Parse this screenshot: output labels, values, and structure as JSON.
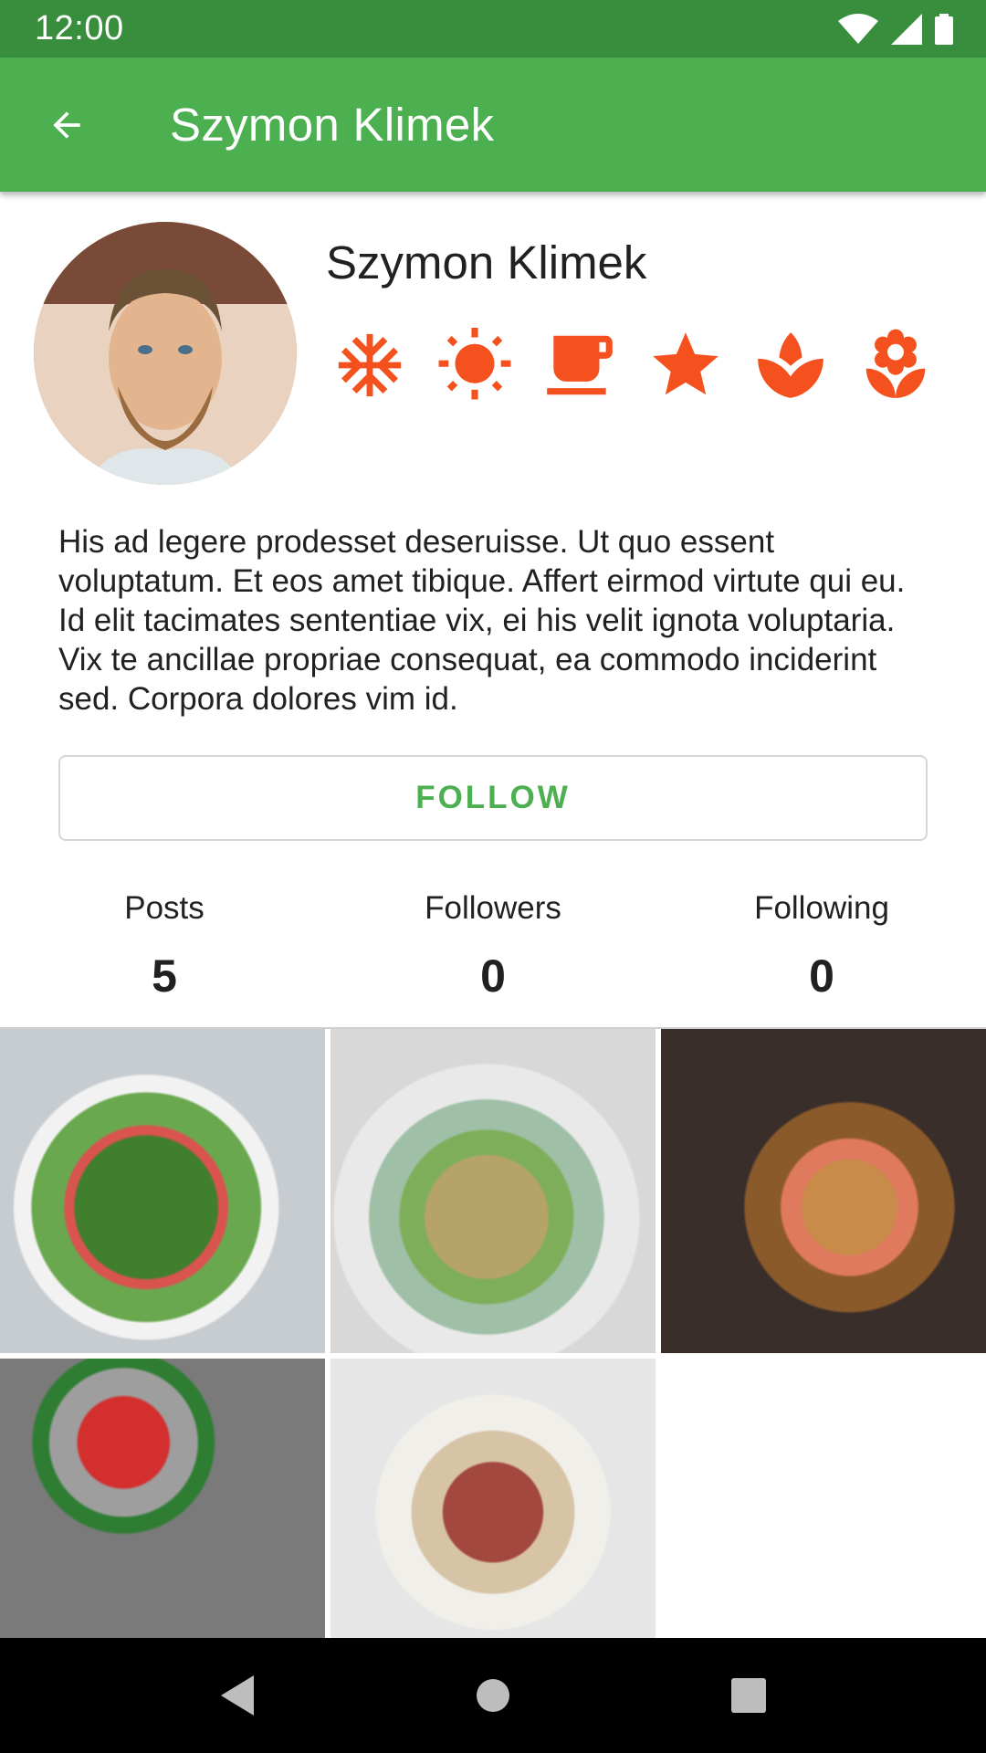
{
  "status_bar": {
    "time": "12:00",
    "icons": [
      "wifi-icon",
      "signal-icon",
      "battery-icon"
    ]
  },
  "app_bar": {
    "title": "Szymon Klimek",
    "back_icon": "arrow-back-icon"
  },
  "profile": {
    "name": "Szymon Klimek",
    "badges": [
      "snowflake-icon",
      "sun-icon",
      "coffee-icon",
      "star-icon",
      "leaf-icon",
      "flower-icon"
    ],
    "bio": "His ad legere prodesset deseruisse. Ut quo essent voluptatum. Et eos amet tibique. Affert eirmod virtute qui eu. Id elit tacimates sententiae vix, ei his velit ignota voluptaria. Vix te ancillae propriae consequat, ea commodo inciderint sed. Corpora dolores vim id.",
    "follow_label": "FOLLOW"
  },
  "stats": [
    {
      "label": "Posts",
      "value": "5"
    },
    {
      "label": "Followers",
      "value": "0"
    },
    {
      "label": "Following",
      "value": "0"
    }
  ],
  "photos": [
    "salad-photo",
    "rice-egg-photo",
    "bagels-salmon-photo",
    "vegetables-photo",
    "bacon-rolls-photo"
  ],
  "nav": [
    "back-triangle-icon",
    "home-circle-icon",
    "recents-square-icon"
  ],
  "colors": {
    "status_bar": "#388e3c",
    "app_bar": "#4caf50",
    "accent": "#4caf50",
    "badge": "#f4511e"
  }
}
